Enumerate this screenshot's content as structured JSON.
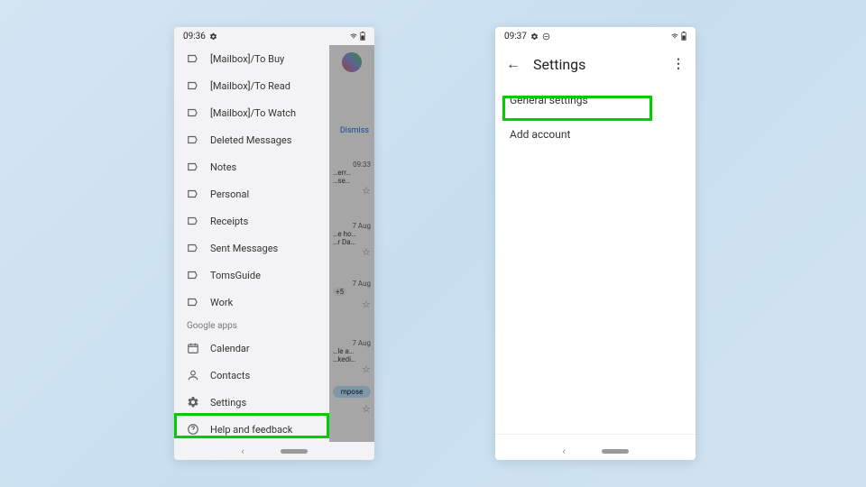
{
  "left": {
    "status": {
      "time": "09:36"
    },
    "drawer": {
      "labels": [
        {
          "text": "[Mailbox]/To Buy"
        },
        {
          "text": "[Mailbox]/To Read"
        },
        {
          "text": "[Mailbox]/To Watch"
        },
        {
          "text": "Deleted Messages"
        },
        {
          "text": "Notes"
        },
        {
          "text": "Personal"
        },
        {
          "text": "Receipts"
        },
        {
          "text": "Sent Messages"
        },
        {
          "text": "TomsGuide"
        },
        {
          "text": "Work"
        }
      ],
      "section": "Google apps",
      "apps": [
        {
          "text": "Calendar"
        },
        {
          "text": "Contacts"
        }
      ],
      "settings": "Settings",
      "help": "Help and feedback"
    },
    "peek": {
      "dismiss": "Dismiss",
      "rows": [
        {
          "time": "09:33",
          "l1": "…err…",
          "l2": "…se…"
        },
        {
          "time": "7 Aug",
          "l1": "…e ho…",
          "l2": "…r Da…"
        },
        {
          "time": "7 Aug",
          "l1": "",
          "l2": "+5"
        },
        {
          "time": "7 Aug",
          "l1": "…le a…",
          "l2": "…kedi…"
        },
        {
          "time": "",
          "l1": "mpose",
          "l2": ""
        }
      ]
    }
  },
  "right": {
    "status": {
      "time": "09:37"
    },
    "title": "Settings",
    "items": [
      {
        "text": "General settings"
      },
      {
        "text": "Add account"
      }
    ]
  }
}
